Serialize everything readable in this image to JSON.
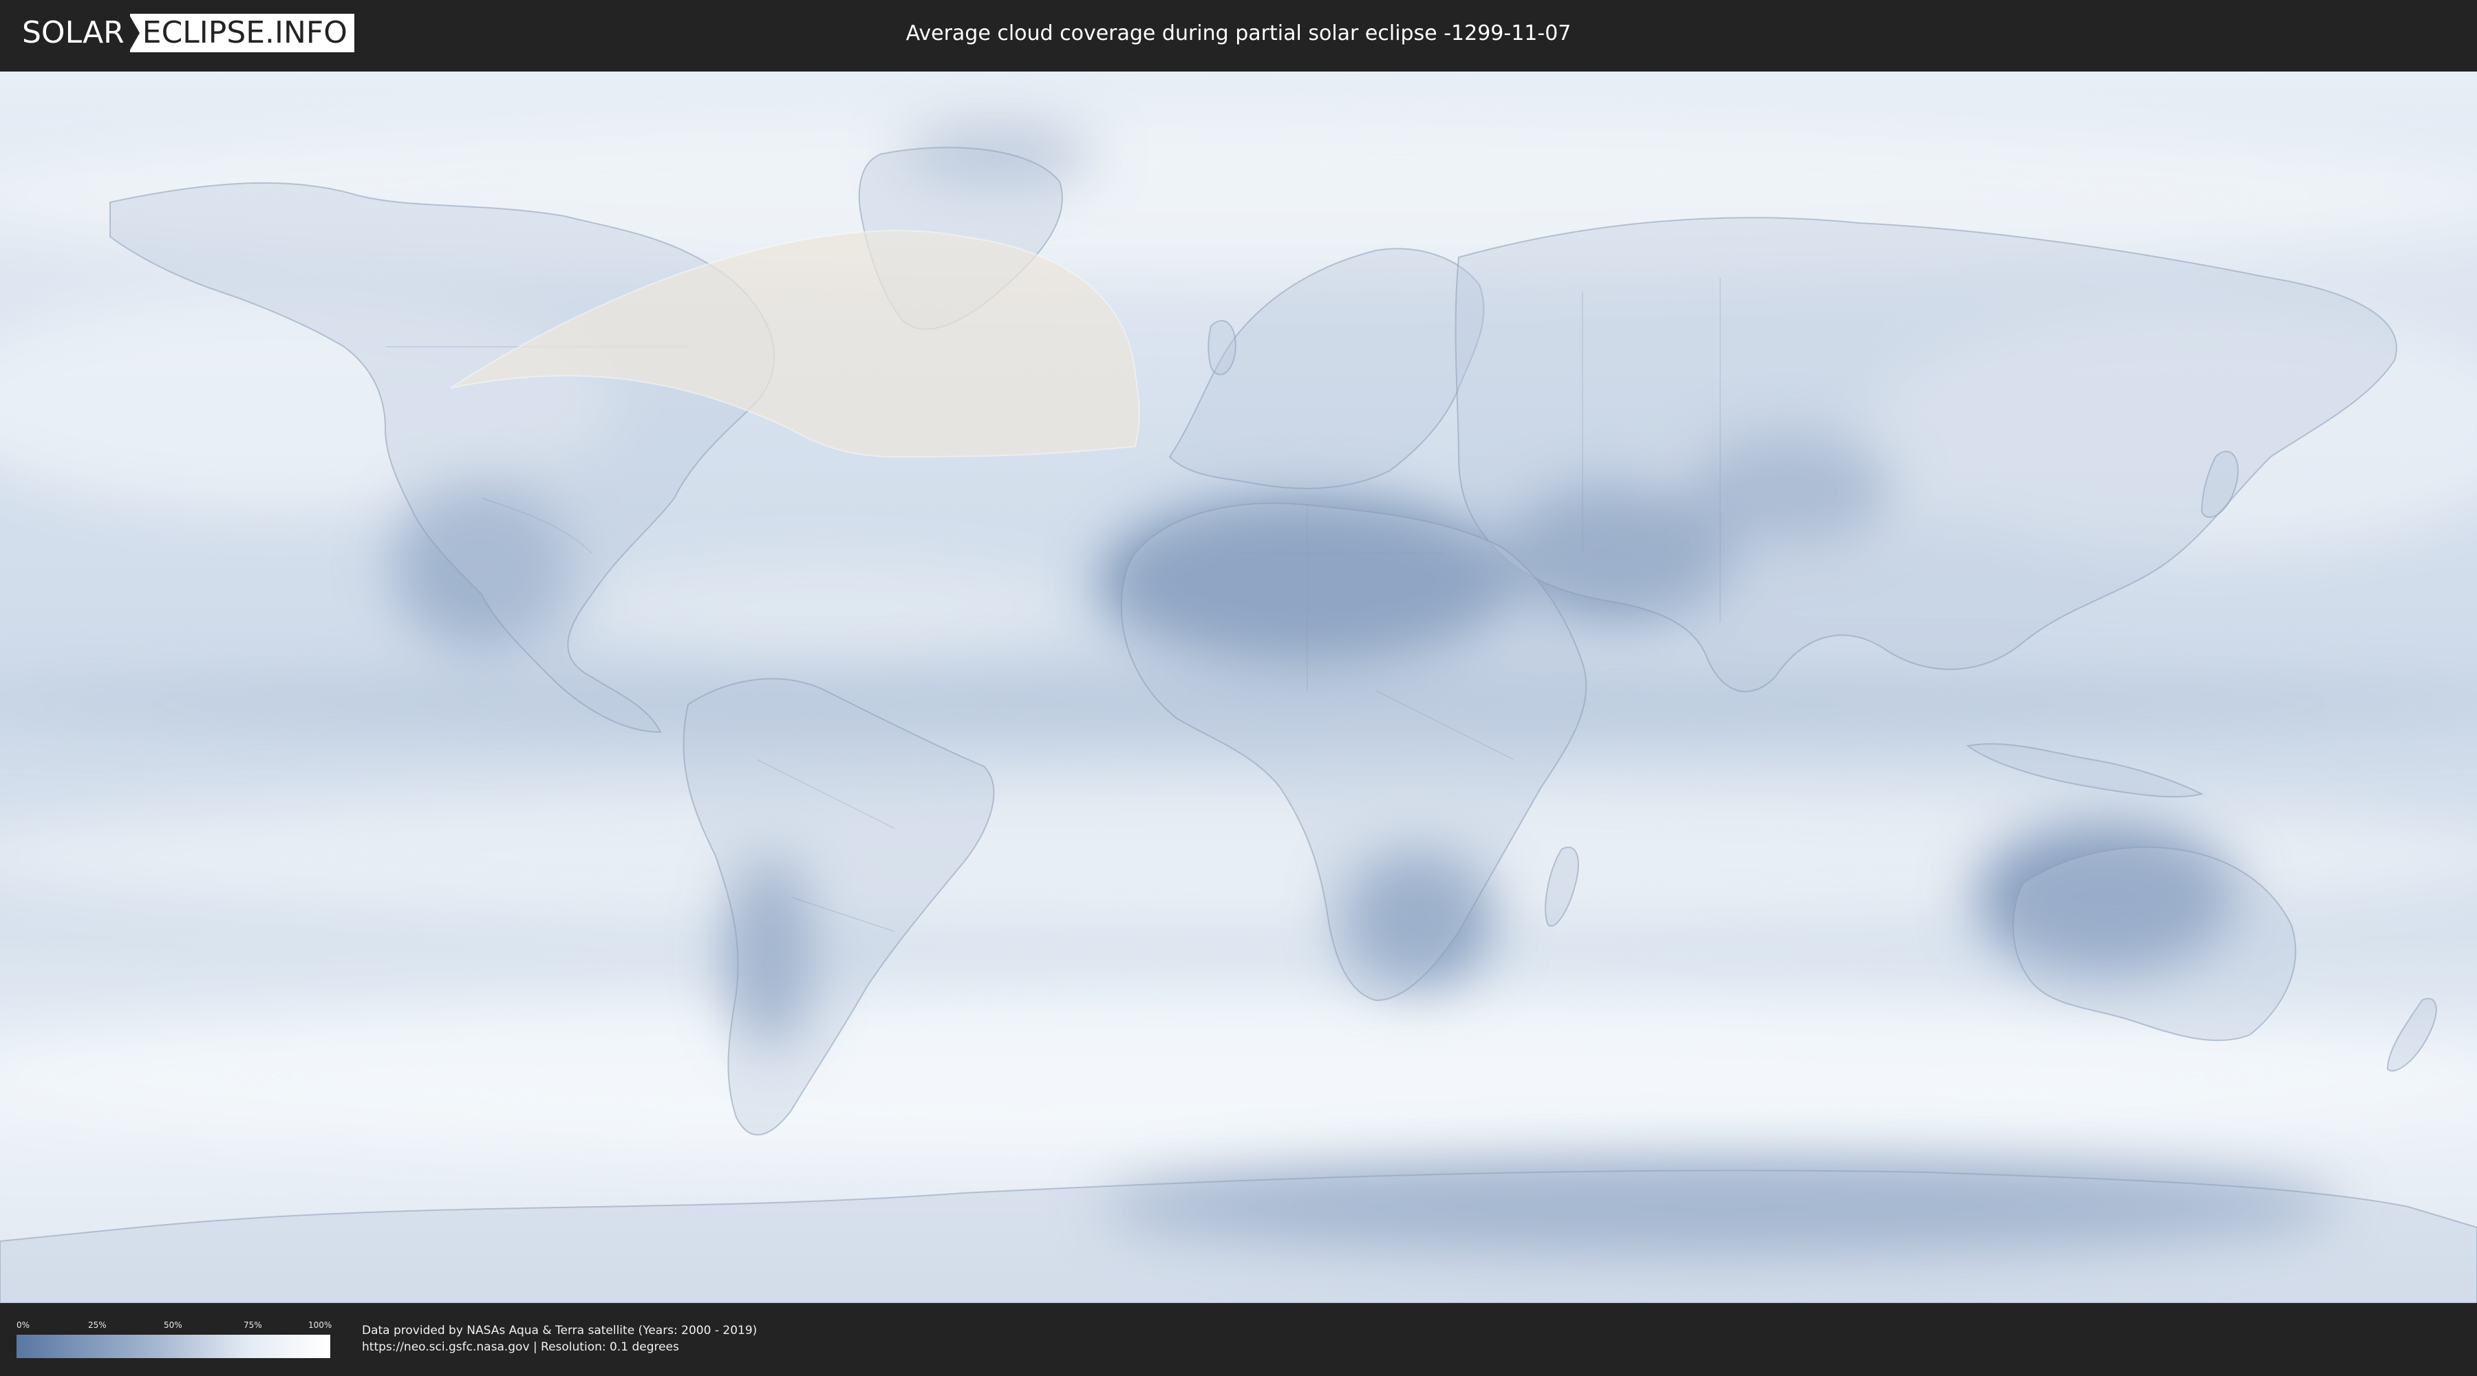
{
  "header": {
    "logo_left": "SOLAR",
    "logo_right": "ECLIPSE.INFO",
    "title": "Average cloud coverage during partial solar eclipse -1299-11-07"
  },
  "legend": {
    "ticks": [
      "0%",
      "25%",
      "50%",
      "75%",
      "100%"
    ],
    "gradient_colors": [
      "#5a77a2",
      "#a6b8d1",
      "#e6ecf4",
      "#ffffff"
    ]
  },
  "footer": {
    "credit_line1": "Data provided by NASAs Aqua & Terra satellite (Years: 2000 - 2019)",
    "credit_line2": "https://neo.sci.gsfc.nasa.gov | Resolution: 0.1 degrees"
  },
  "map": {
    "cloud_bright": "#f3f6fa",
    "cloud_mid": "#c4d3e5",
    "cloud_dark": "#6f89b0",
    "eclipse_zone_color": "#ece6dc"
  }
}
